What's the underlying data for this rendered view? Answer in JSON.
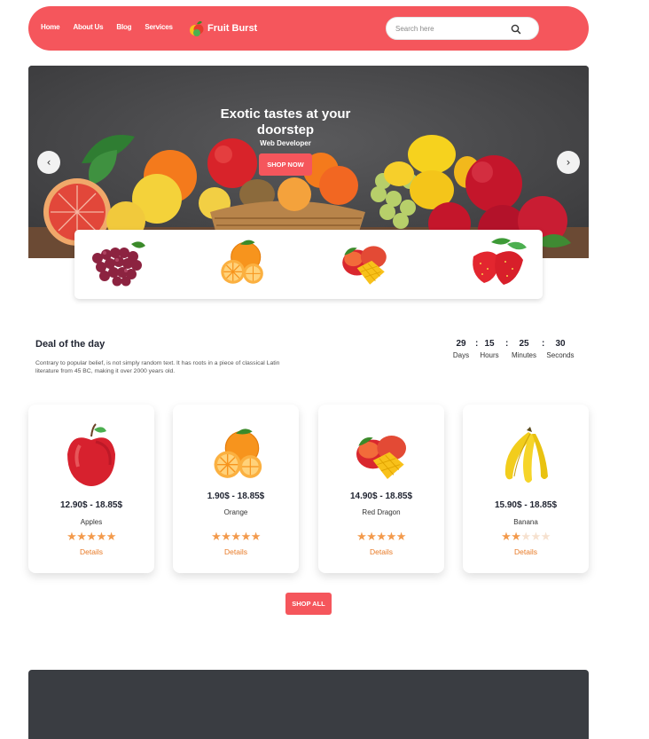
{
  "nav": {
    "links": [
      "Home",
      "About Us",
      "Blog",
      "Services"
    ],
    "brand": "Fruit Burst",
    "search_placeholder": "Search here",
    "color": "#f5565c"
  },
  "hero": {
    "title": "Exotic tastes at your doorstep",
    "subtitle": "Web Developer",
    "button": "SHOP NOW",
    "prev_icon": "chevron-left-icon",
    "next_icon": "chevron-right-icon",
    "prev_glyph": "‹",
    "next_glyph": "›"
  },
  "strip": {
    "items": [
      "grapes",
      "orange",
      "mango",
      "strawberry"
    ]
  },
  "deal": {
    "title": "Deal of the day",
    "description": "Contrary to popular belief, is not simply random text. It has roots in a piece of classical Latin literature from 45 BC, making it over 2000 years old.",
    "countdown": [
      {
        "value": "29",
        "label": "Days"
      },
      {
        "value": "15",
        "label": "Hours"
      },
      {
        "value": "25",
        "label": "Minutes"
      },
      {
        "value": "30",
        "label": "Seconds"
      }
    ],
    "separator": ":"
  },
  "products": [
    {
      "image": "apple",
      "price": "12.90$ - 18.85$",
      "name": "Apples",
      "rating": 5,
      "link": "Details"
    },
    {
      "image": "orange",
      "price": "1.90$ - 18.85$",
      "name": "Orange",
      "rating": 5,
      "link": "Details"
    },
    {
      "image": "mango",
      "price": "14.90$ - 18.85$",
      "name": "Red Dragon",
      "rating": 5,
      "link": "Details"
    },
    {
      "image": "banana",
      "price": "15.90$ - 18.85$",
      "name": "Banana",
      "rating": 2,
      "link": "Details"
    }
  ],
  "rating_max": 5,
  "shop_all": "SHOP ALL",
  "colors": {
    "accent": "#f5565c",
    "star": "#f39a4c",
    "link": "#e87a26",
    "footer": "#3a3d42"
  }
}
